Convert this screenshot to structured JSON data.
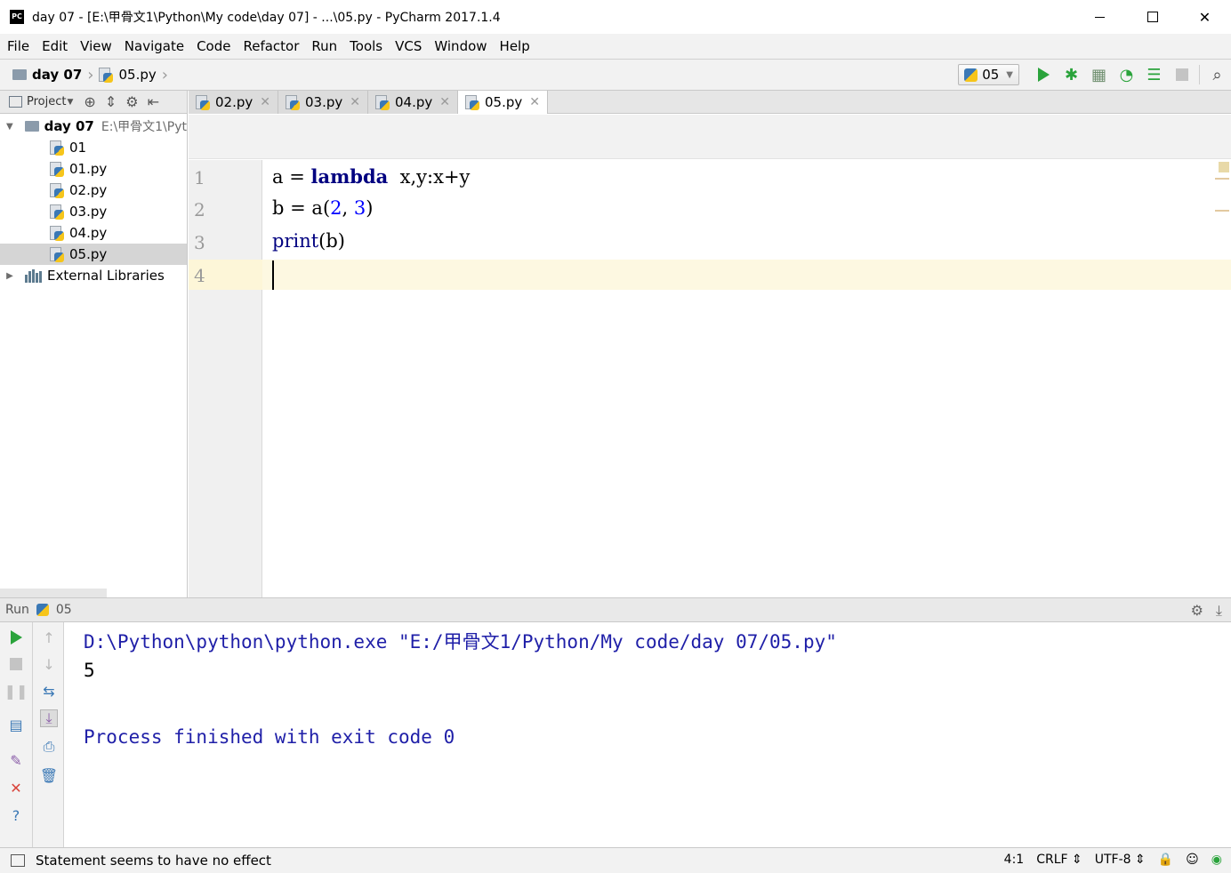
{
  "window": {
    "title": "day 07 - [E:\\甲骨文1\\Python\\My code\\day 07] - ...\\05.py - PyCharm 2017.1.4",
    "logo_text": "PC"
  },
  "menu": [
    "File",
    "Edit",
    "View",
    "Navigate",
    "Code",
    "Refactor",
    "Run",
    "Tools",
    "VCS",
    "Window",
    "Help"
  ],
  "breadcrumb": {
    "project": "day 07",
    "file": "05.py"
  },
  "run_config": {
    "selected": "05"
  },
  "sidebar": {
    "header_label": "Project",
    "root": {
      "name": "day 07",
      "path": "E:\\甲骨文1\\Pyt"
    },
    "items": [
      {
        "name": "01"
      },
      {
        "name": "01.py"
      },
      {
        "name": "02.py"
      },
      {
        "name": "03.py"
      },
      {
        "name": "04.py"
      },
      {
        "name": "05.py"
      }
    ],
    "external": "External Libraries"
  },
  "tabs": [
    {
      "label": "02.py"
    },
    {
      "label": "03.py"
    },
    {
      "label": "04.py"
    },
    {
      "label": "05.py",
      "active": true
    }
  ],
  "editor": {
    "line_numbers": [
      "1",
      "2",
      "3",
      "4"
    ],
    "lines": [
      {
        "t1": "a ",
        "op": "=",
        "kw": "lambda",
        "rest": "x,y:x+y"
      },
      {
        "t1": "b ",
        "op": "=",
        "call": "a",
        "lp": "(",
        "n1": "2",
        "comma": ",",
        "n2": "3",
        "rp": ")"
      },
      {
        "bi": "print",
        "args": "(b)"
      }
    ]
  },
  "run_panel": {
    "label": "Run",
    "config": "05",
    "console": {
      "command": "D:\\Python\\python\\python.exe \"E:/甲骨文1/Python/My code/day 07/05.py\"",
      "output": "5",
      "finish": "Process finished with exit code 0"
    }
  },
  "status": {
    "message": "Statement seems to have no effect",
    "position": "4:1",
    "line_sep": "CRLF",
    "encoding": "UTF-8"
  },
  "colors": {
    "keyword": "#000080",
    "number": "#0000ff",
    "console_blue": "#1f1fa8",
    "current_line": "#fdf8e1",
    "run_green": "#2aa33b"
  }
}
